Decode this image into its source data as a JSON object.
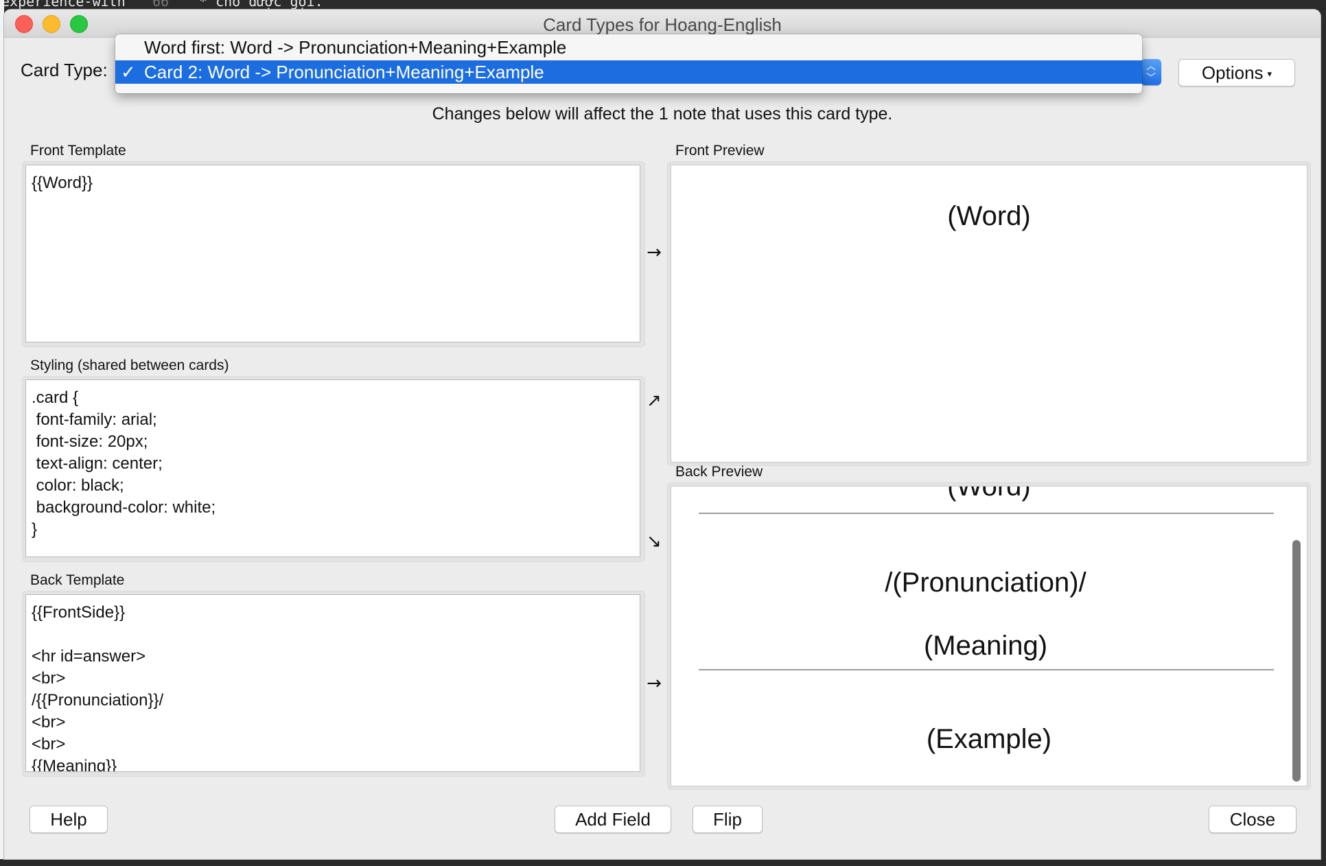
{
  "background": {
    "editor_fragment_left": "experience-with",
    "editor_fragment_middle": "66",
    "editor_fragment_right": "* cho được gọi."
  },
  "window": {
    "title": "Card Types for Hoang-English"
  },
  "card_type": {
    "label": "Card Type:",
    "options": [
      {
        "label": "Word first: Word -> Pronunciation+Meaning+Example",
        "selected": false
      },
      {
        "label": "Card 2: Word -> Pronunciation+Meaning+Example",
        "selected": true
      }
    ],
    "check_mark": "✓",
    "options_button": "Options",
    "options_caret": "▾"
  },
  "info_text": "Changes below will affect the 1 note that uses this card type.",
  "front_template": {
    "label": "Front Template",
    "content": "{{Word}}"
  },
  "styling": {
    "label": "Styling (shared between cards)",
    "content": ".card {\n font-family: arial;\n font-size: 20px;\n text-align: center;\n color: black;\n background-color: white;\n}"
  },
  "back_template": {
    "label": "Back Template",
    "content": "{{FrontSide}}\n\n<hr id=answer>\n<br>\n/{{Pronunciation}}/\n<br>\n<br>\n{{Meaning}}"
  },
  "arrows": {
    "front": "→",
    "styling_up": "↗",
    "styling_down": "↘",
    "back": "→"
  },
  "front_preview": {
    "label": "Front Preview",
    "word": "(Word)"
  },
  "back_preview": {
    "label": "Back Preview",
    "word": "(Word)",
    "pronunciation": "/(Pronunciation)/",
    "meaning": "(Meaning)",
    "example": "(Example)"
  },
  "buttons": {
    "help": "Help",
    "add_field": "Add Field",
    "flip": "Flip",
    "close": "Close"
  },
  "colors": {
    "selection": "#1c6de0",
    "window_bg": "#ececec"
  }
}
